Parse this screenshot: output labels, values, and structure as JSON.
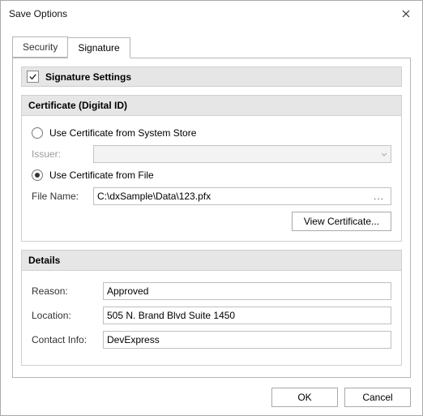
{
  "window": {
    "title": "Save Options"
  },
  "tabs": {
    "security": "Security",
    "signature": "Signature",
    "active": "signature"
  },
  "signature_settings": {
    "header": "Signature Settings",
    "enabled": true
  },
  "certificate": {
    "header": "Certificate (Digital ID)",
    "opt_system_store": "Use Certificate from System Store",
    "opt_from_file": "Use Certificate from File",
    "selected": "file",
    "issuer_label": "Issuer:",
    "issuer_value": "",
    "filename_label": "File Name:",
    "filename_value": "C:\\dxSample\\Data\\123.pfx",
    "browse": "...",
    "view_cert": "View Certificate..."
  },
  "details": {
    "header": "Details",
    "reason_label": "Reason:",
    "reason_value": "Approved",
    "location_label": "Location:",
    "location_value": "505 N. Brand Blvd Suite 1450",
    "contact_label": "Contact Info:",
    "contact_value": "DevExpress"
  },
  "footer": {
    "ok": "OK",
    "cancel": "Cancel"
  }
}
